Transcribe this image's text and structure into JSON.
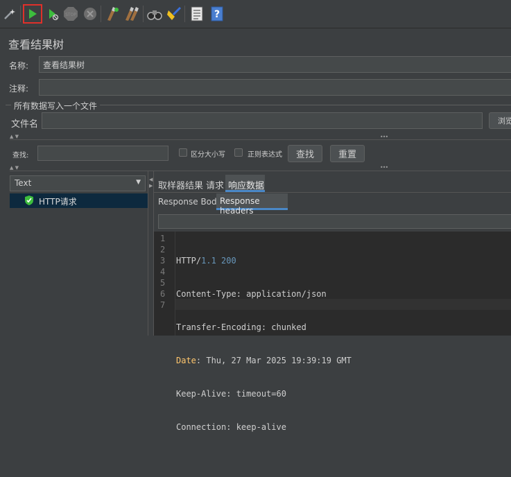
{
  "window": {
    "title": "查看结果树"
  },
  "form": {
    "name_label": "名称:",
    "name_value": "查看结果树",
    "comment_label": "注释:",
    "comment_value": "",
    "group_label": "所有数据写入一个文件",
    "filename_label": "文件名",
    "filename_value": "",
    "browse_label": "浏览"
  },
  "search": {
    "label": "查找:",
    "value": "",
    "case_sensitive_label": "区分大小写",
    "regex_label": "正则表达式",
    "find_button": "查找",
    "reset_button": "重置"
  },
  "tree": {
    "renderer_selected": "Text",
    "items": [
      {
        "label": "HTTP请求",
        "status": "success"
      }
    ]
  },
  "tabs": {
    "main": [
      "取样器结果",
      "请求",
      "响应数据"
    ],
    "main_active": "响应数据",
    "sub": [
      "Response Body",
      "Response headers"
    ],
    "sub_active": "Response headers"
  },
  "response_headers": {
    "line_numbers": [
      "1",
      "2",
      "3",
      "4",
      "5",
      "6",
      "7"
    ],
    "lines": [
      {
        "key": "HTTP/",
        "num1": "1.1",
        "sep": " ",
        "num2": "200",
        "rest": ""
      },
      {
        "key": "Content-Type",
        "sep": ": ",
        "value": "application/json"
      },
      {
        "key": "Transfer-Encoding",
        "sep": ": ",
        "value": "chunked"
      },
      {
        "key": "Date",
        "sep": ": ",
        "value": "Thu, 27 Mar 2025 19:39:19 GMT"
      },
      {
        "key": "Keep-Alive",
        "sep": ": ",
        "value": "timeout=60"
      },
      {
        "key": "Connection",
        "sep": ": ",
        "value": "keep-alive"
      },
      {
        "key": "",
        "sep": "",
        "value": ""
      }
    ]
  },
  "colors": {
    "background": "#3c3f41",
    "field": "#45494a",
    "editor": "#2b2b2b",
    "accent": "#4a88c7",
    "run": "#3dbd3d",
    "date_key": "#ffc66d",
    "number": "#6897bb",
    "selection": "#0d293e"
  },
  "icons": {
    "toolbar": [
      "wand-icon",
      "run-icon",
      "run-no-pause-icon",
      "stop-icon",
      "shutdown-icon",
      "clear-icon",
      "clear-all-icon",
      "search-binoculars-icon",
      "broom-icon",
      "log-viewer-icon",
      "help-icon"
    ]
  }
}
